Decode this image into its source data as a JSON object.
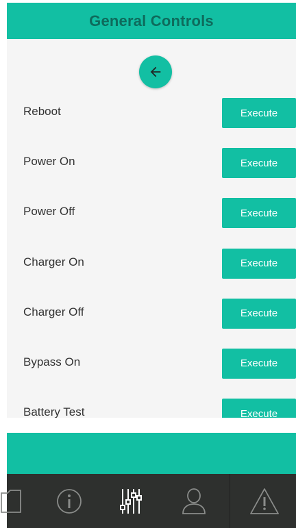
{
  "header": {
    "title": "General Controls"
  },
  "back_button": {
    "icon": "arrow-left-icon"
  },
  "controls": [
    {
      "label": "Reboot",
      "action": "Execute"
    },
    {
      "label": "Power On",
      "action": "Execute"
    },
    {
      "label": "Power Off",
      "action": "Execute"
    },
    {
      "label": "Charger On",
      "action": "Execute"
    },
    {
      "label": "Charger Off",
      "action": "Execute"
    },
    {
      "label": "Bypass On",
      "action": "Execute"
    },
    {
      "label": "Battery Test",
      "action": "Execute"
    }
  ],
  "nav": {
    "items": [
      {
        "icon": "folder-icon"
      },
      {
        "icon": "info-icon"
      },
      {
        "icon": "sliders-icon"
      },
      {
        "icon": "user-icon"
      },
      {
        "icon": "warning-icon"
      }
    ]
  },
  "colors": {
    "accent": "#12bfa3",
    "header_text": "#0e6b5c",
    "content_bg": "#f5f5f5",
    "nav_bg": "#2e302e",
    "nav_icon": "#8a8c8a",
    "nav_icon_active": "#ffffff"
  }
}
